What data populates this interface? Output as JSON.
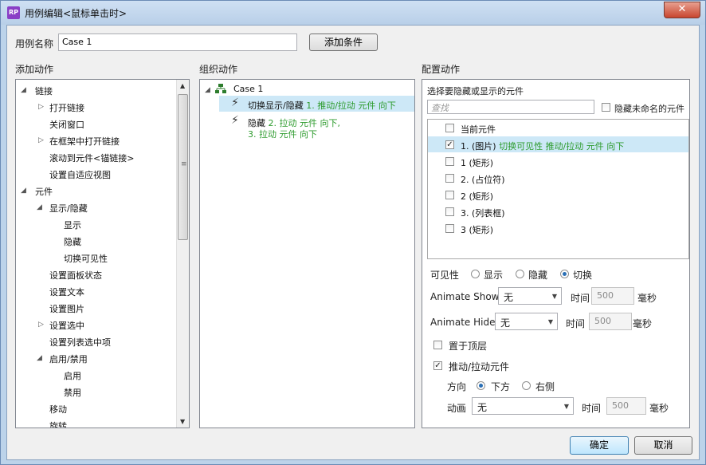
{
  "window": {
    "title": "用例编辑<鼠标单击时>",
    "app_icon": "RP",
    "close_glyph": "✕"
  },
  "header": {
    "case_name_label": "用例名称",
    "case_name_value": "Case 1",
    "add_condition_label": "添加条件"
  },
  "add_actions": {
    "title": "添加动作",
    "items": [
      {
        "label": "链接"
      },
      {
        "label": "打开链接"
      },
      {
        "label": "关闭窗口"
      },
      {
        "label": "在框架中打开链接"
      },
      {
        "label": "滚动到元件<锚链接>"
      },
      {
        "label": "设置自适应视图"
      },
      {
        "label": "元件"
      },
      {
        "label": "显示/隐藏"
      },
      {
        "label": "显示"
      },
      {
        "label": "隐藏"
      },
      {
        "label": "切换可见性"
      },
      {
        "label": "设置面板状态"
      },
      {
        "label": "设置文本"
      },
      {
        "label": "设置图片"
      },
      {
        "label": "设置选中"
      },
      {
        "label": "设置列表选中项"
      },
      {
        "label": "启用/禁用"
      },
      {
        "label": "启用"
      },
      {
        "label": "禁用"
      },
      {
        "label": "移动"
      },
      {
        "label": "旋转"
      }
    ]
  },
  "organize_actions": {
    "title": "组织动作",
    "case_label": "Case 1",
    "actions": [
      {
        "name": "切换显示/隐藏",
        "detail": "1. 推动/拉动 元件 向下"
      },
      {
        "name": "隐藏",
        "detail": "2. 拉动 元件 向下,",
        "detail2": "3. 拉动 元件 向下"
      }
    ]
  },
  "configure": {
    "title": "配置动作",
    "subtitle": "选择要隐藏或显示的元件",
    "search_placeholder": "查找",
    "hide_unnamed_label": "隐藏未命名的元件",
    "widgets": [
      {
        "label": "当前元件",
        "extra": "",
        "checked": false
      },
      {
        "label": "1. (图片)",
        "extra": "切换可见性 推动/拉动 元件 向下",
        "checked": true
      },
      {
        "label": "1 (矩形)",
        "extra": "",
        "checked": false
      },
      {
        "label": "2. (占位符)",
        "extra": "",
        "checked": false
      },
      {
        "label": "2 (矩形)",
        "extra": "",
        "checked": false
      },
      {
        "label": "3. (列表框)",
        "extra": "",
        "checked": false
      },
      {
        "label": "3 (矩形)",
        "extra": "",
        "checked": false
      }
    ],
    "visibility": {
      "label": "可见性",
      "options": [
        "显示",
        "隐藏",
        "切换"
      ],
      "selected": "切换"
    },
    "animate_show": {
      "label": "Animate Show",
      "value": "无",
      "time_label": "时间",
      "time_value": "500",
      "unit": "毫秒"
    },
    "animate_hide": {
      "label": "Animate Hide",
      "value": "无",
      "time_label": "时间",
      "time_value": "500",
      "unit": "毫秒"
    },
    "bring_to_front": {
      "label": "置于顶层",
      "checked": false
    },
    "push_pull": {
      "label": "推动/拉动元件",
      "checked": true
    },
    "direction": {
      "label": "方向",
      "options": [
        "下方",
        "右侧"
      ],
      "selected": "下方"
    },
    "animation": {
      "label": "动画",
      "value": "无",
      "time_label": "时间",
      "time_value": "500",
      "unit": "毫秒"
    }
  },
  "footer": {
    "ok_label": "确定",
    "cancel_label": "取消"
  },
  "colors": {
    "selection": "#cde8f7",
    "highlight_text": "#2d9b2d",
    "primary_button": "#bee6fd"
  }
}
